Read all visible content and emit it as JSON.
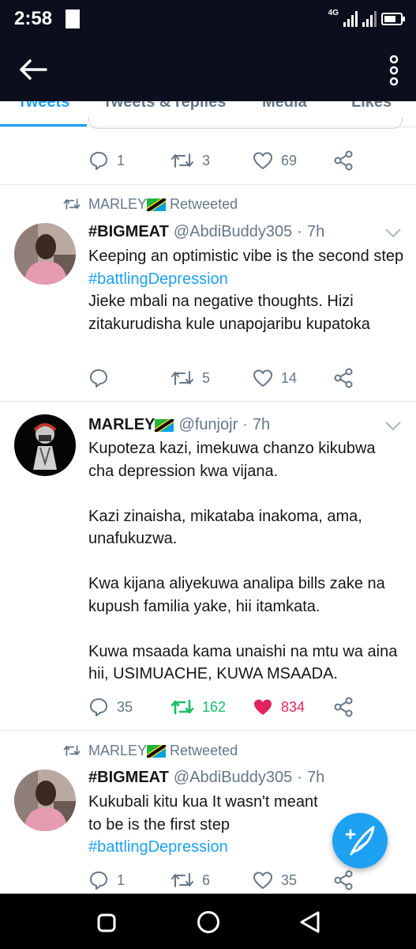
{
  "status_bar": {
    "time": "2:58",
    "network": "4G"
  },
  "tabs": [
    "Tweets",
    "Tweets & replies",
    "Media",
    "Likes"
  ],
  "top_tweet_actions": {
    "replies": "1",
    "retweets": "3",
    "likes": "69"
  },
  "tweets": [
    {
      "retweeted_by": "MARLEY",
      "retweeted_label": "Retweeted",
      "name": "#BIGMEAT",
      "handle": "@AbdiBuddy305",
      "time": "7h",
      "line1": "Keeping an optimistic vibe is the second step",
      "hashtag": "#battlingDepression",
      "line2": "Jieke mbali na negative thoughts. Hizi zitakurudisha kule unapojaribu kupatoka",
      "replies": "",
      "retweets": "5",
      "likes": "14"
    },
    {
      "name": "MARLEY",
      "handle": "@funjojr",
      "time": "7h",
      "para1": "Kupoteza kazi, imekuwa chanzo kikubwa cha depression kwa vijana.",
      "para2": "Kazi zinaisha, mikataba inakoma, ama, unafukuzwa.",
      "para3": "Kwa kijana aliyekuwa analipa bills zake na kupush familia yake, hii itamkata.",
      "para4": "Kuwa msaada kama unaishi na mtu wa aina hii, USIMUACHE, KUWA MSAADA.",
      "replies": "35",
      "retweets": "162",
      "likes": "834"
    },
    {
      "retweeted_by": "MARLEY",
      "retweeted_label": "Retweeted",
      "name": "#BIGMEAT",
      "handle": "@AbdiBuddy305",
      "time": "7h",
      "line1": "Kukubali kitu kua It wasn't meant to be is the first step",
      "hashtag": "#battlingDepression",
      "replies": "1",
      "retweets": "6",
      "likes": "35"
    }
  ],
  "dot": "·",
  "colors": {
    "bar": "#0b0e1c",
    "accent": "#1da1f2",
    "retweet_active": "#17bf63",
    "like_active": "#e0245e",
    "muted": "#657786"
  }
}
